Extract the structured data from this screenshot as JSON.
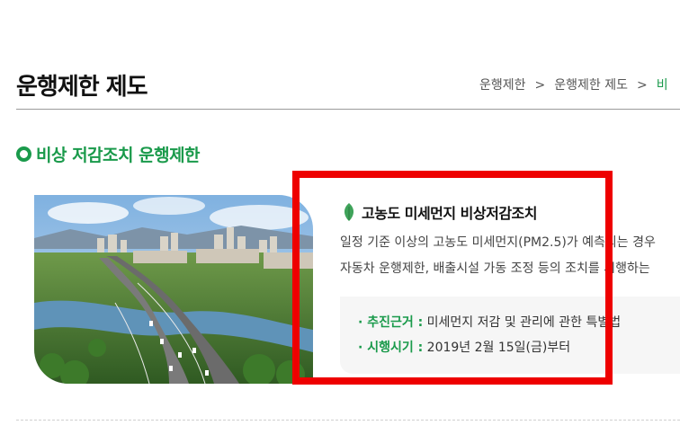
{
  "page": {
    "title": "운행제한 제도"
  },
  "breadcrumb": {
    "items": [
      "운행제한",
      "운행제한 제도",
      "비"
    ],
    "separator": ">"
  },
  "section": {
    "heading": "비상 저감조치 운행제한"
  },
  "card": {
    "image_alt": "highway city aerial photo",
    "title": "고농도 미세먼지 비상저감조치",
    "desc_line1": "일정 기준 이상의 고농도 미세먼지(PM2.5)가 예측되는 경우",
    "desc_line2": "자동차 운행제한, 배출시설 가동 조정 등의 조치를 시행하는",
    "info": {
      "basis_label": "추진근거 :",
      "basis_value": "미세먼지 저감 및 관리에 관한 특별법",
      "date_label": "시행시기 :",
      "date_value": "2019년 2월 15일(금)부터"
    }
  },
  "colors": {
    "accent": "#1a9a4b",
    "highlight": "#ee0000"
  }
}
